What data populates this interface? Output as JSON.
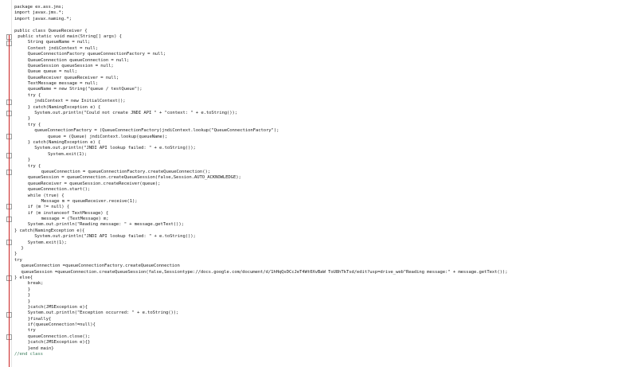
{
  "editor": {
    "lines": [
      {
        "text": "package ex.ass.jms;",
        "indent": 0
      },
      {
        "text": "import javax.jms.*;",
        "indent": 0
      },
      {
        "text": "import javax.naming.*;",
        "indent": 0
      },
      {
        "text": "",
        "indent": 0
      },
      {
        "text": "public class QueueReceiver {",
        "indent": 0
      },
      {
        "text": "public static void main(String[] args) {",
        "indent": 1
      },
      {
        "text": "String queueName = null;",
        "indent": 4
      },
      {
        "text": "Context jndiContext = null;",
        "indent": 4
      },
      {
        "text": "QueueConnectionFactory queueConnectionFactory = null;",
        "indent": 4
      },
      {
        "text": "QueueConnection queueConnection = null;",
        "indent": 4
      },
      {
        "text": "QueueSession queueSession = null;",
        "indent": 4
      },
      {
        "text": "Queue queue = null;",
        "indent": 4
      },
      {
        "text": "QueueReceiver queueReceiver = null;",
        "indent": 4
      },
      {
        "text": "TextMessage message = null;",
        "indent": 4
      },
      {
        "text": "queueName = new String(\"queue / testQueue\");",
        "indent": 4
      },
      {
        "text": "try {",
        "indent": 4
      },
      {
        "text": "jndiContext = new InitialContext();",
        "indent": 6
      },
      {
        "text": "} catch(NamingException e) {",
        "indent": 4
      },
      {
        "text": "System.out.println(\"Could not create JNDI API \" + \"context: \" + e.toString());",
        "indent": 6
      },
      {
        "text": "}",
        "indent": 4
      },
      {
        "text": "try {",
        "indent": 4
      },
      {
        "text": "queueConnectionFactory = (QueueConnectionFactory)jndiContext.lookup(\"QueueConnectionFactory\");",
        "indent": 6
      },
      {
        "text": "queue = (Queue) jndiContext.lookup(queueName);",
        "indent": 10
      },
      {
        "text": "} catch(NamingException e) {",
        "indent": 4
      },
      {
        "text": "System.out.println(\"JNDI API lookup failed: \" + e.toString());",
        "indent": 6
      },
      {
        "text": "System.exit(1);",
        "indent": 10
      },
      {
        "text": "}",
        "indent": 4
      },
      {
        "text": "try {",
        "indent": 4
      },
      {
        "text": "queueConnection = queueConnectionFactory.createQueueConnection();",
        "indent": 8
      },
      {
        "text": "queueSession = queueConnection.createQueueSession(false,Session.AUTO_ACKNOWLEDGE);",
        "indent": 4
      },
      {
        "text": "queueReceiver = queueSession.createReceiver(queue);",
        "indent": 4
      },
      {
        "text": "queueConnection.start();",
        "indent": 4
      },
      {
        "text": "while (true) {",
        "indent": 4
      },
      {
        "text": "Message m = queueReceiver.receive(1);",
        "indent": 8
      },
      {
        "text": "if (m != null) {",
        "indent": 4
      },
      {
        "text": "if (m instanceof TextMessage) {",
        "indent": 4
      },
      {
        "text": "message = (TextMessage) m;",
        "indent": 8
      },
      {
        "text": "System.out.println(\"Reading message: \" + message.getText());",
        "indent": 4
      },
      {
        "text": "} catch(NamingException e){",
        "indent": 0
      },
      {
        "text": "System.out.println(\"JNDI API lookup failed: \" + e.toString());",
        "indent": 6
      },
      {
        "text": "System.exit(1);",
        "indent": 4
      },
      {
        "text": "}",
        "indent": 2
      },
      {
        "text": "}",
        "indent": 0
      },
      {
        "text": "try",
        "indent": 0
      },
      {
        "text": "queueConnection =queueConnectionFactory.createQueueConnection",
        "indent": 2
      },
      {
        "text": "queueSession =queueConnection.createQueueSession(false,Sessiontype://docs.google.com/document/d/1hHqQsDCcJeT4Wt0XvBaW ToU8hTkTsd/edit?usp=drive_web\"Reading message:\" + message.getText());",
        "indent": 2
      },
      {
        "text": "} else{",
        "indent": 0
      },
      {
        "text": "break;",
        "indent": 4
      },
      {
        "text": "}",
        "indent": 4
      },
      {
        "text": "}",
        "indent": 4
      },
      {
        "text": "}",
        "indent": 4
      },
      {
        "text": "}catch(JMSException e){",
        "indent": 4
      },
      {
        "text": "System.out.println(\"Exception occurred: \" + e.toString());",
        "indent": 4
      },
      {
        "text": "}finally{",
        "indent": 4
      },
      {
        "text": "if(queueConnection!=null){",
        "indent": 4
      },
      {
        "text": "try",
        "indent": 4
      },
      {
        "text": "queueConnection.close();",
        "indent": 4
      },
      {
        "text": "}catch(JMSException e){}",
        "indent": 4
      },
      {
        "text": "}end main}",
        "indent": 4
      },
      {
        "text": "//end class",
        "indent": 0
      }
    ]
  }
}
